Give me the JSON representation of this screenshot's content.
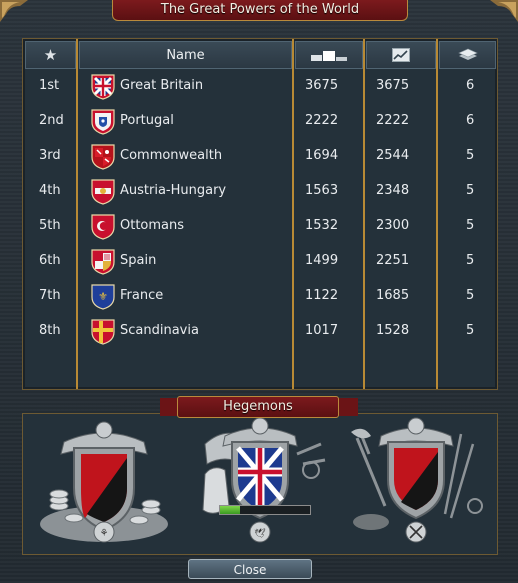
{
  "window": {
    "title": "The Great Powers of the World"
  },
  "table": {
    "headers": {
      "rank": "★",
      "name": "Name",
      "score_icon": "podium-icon",
      "growth_icon": "line-chart-icon",
      "provinces_icon": "stack-icon"
    },
    "rows": [
      {
        "rank": "1st",
        "name": "Great Britain",
        "score": "3675",
        "growth": "3675",
        "provinces": "6",
        "flag": "union-jack-flag"
      },
      {
        "rank": "2nd",
        "name": "Portugal",
        "score": "2222",
        "growth": "2222",
        "provinces": "6",
        "flag": "portugal-flag"
      },
      {
        "rank": "3rd",
        "name": "Commonwealth",
        "score": "1694",
        "growth": "2544",
        "provinces": "5",
        "flag": "commonwealth-flag"
      },
      {
        "rank": "4th",
        "name": "Austria-Hungary",
        "score": "1563",
        "growth": "2348",
        "provinces": "5",
        "flag": "austria-hungary-flag"
      },
      {
        "rank": "5th",
        "name": "Ottomans",
        "score": "1532",
        "growth": "2300",
        "provinces": "5",
        "flag": "ottomans-flag"
      },
      {
        "rank": "6th",
        "name": "Spain",
        "score": "1499",
        "growth": "2251",
        "provinces": "5",
        "flag": "spain-flag"
      },
      {
        "rank": "7th",
        "name": "France",
        "score": "1122",
        "growth": "1685",
        "provinces": "5",
        "flag": "france-flag"
      },
      {
        "rank": "8th",
        "name": "Scandinavia",
        "score": "1017",
        "growth": "1528",
        "provinces": "5",
        "flag": "scandinavia-flag"
      }
    ]
  },
  "hegemons": {
    "title": "Hegemons",
    "economic": {
      "icon": "coins-crest-icon",
      "badge_icon": "economic-badge-icon",
      "flag": "red-black-diagonal-flag"
    },
    "naval": {
      "icon": "horse-crest-icon",
      "badge_icon": "dove-badge-icon",
      "flag": "union-jack-flag",
      "progress": 0.22
    },
    "military": {
      "icon": "weapons-crest-icon",
      "badge_icon": "crossed-swords-badge-icon",
      "flag": "red-black-diagonal-flag"
    }
  },
  "close_label": "Close",
  "colors": {
    "accent": "#b88a35",
    "banner": "#6b1416",
    "progress": "#5cc03a"
  }
}
